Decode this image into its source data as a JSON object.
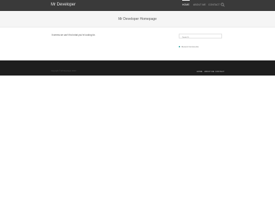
{
  "header": {
    "brand": "Mr Developer",
    "nav": [
      {
        "label": "Home"
      },
      {
        "label": "About Me"
      },
      {
        "label": "Contact"
      }
    ],
    "search_icon": "search-icon"
  },
  "banner": {
    "title": "Mr Developer Homepage"
  },
  "main": {
    "message": "It seems we can't find what you're looking for."
  },
  "sidebar": {
    "search_placeholder": "Search",
    "recent_comments": "Recent Comments"
  },
  "footer": {
    "copyright": "Copyright © Mr Developer 2013",
    "nav": [
      {
        "label": "Home"
      },
      {
        "label": "About Me"
      },
      {
        "label": "Contact"
      }
    ]
  },
  "colors": {
    "header_bg": "#3a3a3a",
    "banner_bg": "#f5f5f5",
    "footer_bg": "#1e1e1e",
    "accent": "#2ea3a3"
  }
}
